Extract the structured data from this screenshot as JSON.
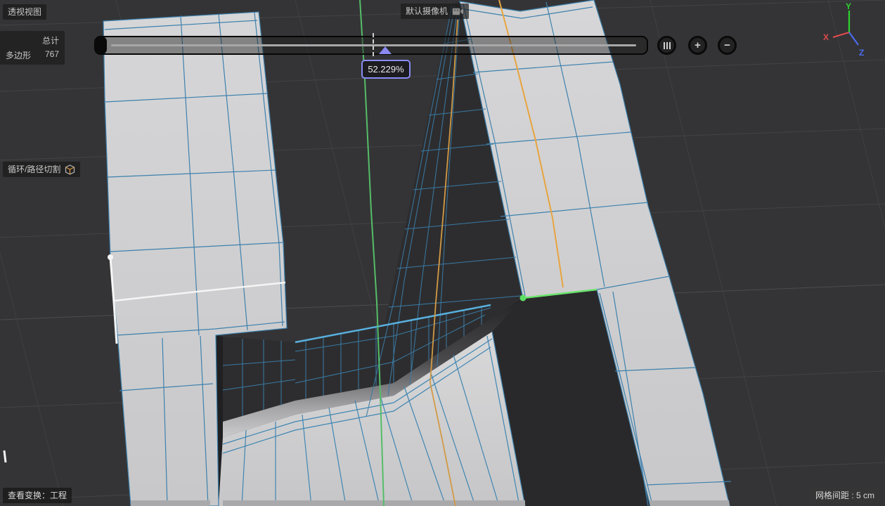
{
  "viewport": {
    "view_label": "透视视图",
    "camera_label": "默认摄像机",
    "stats": {
      "total_label": "总计",
      "polygons_label": "多边形",
      "polygons_value": "767"
    },
    "tool_hint": {
      "label": "循环/路径切割"
    },
    "status_bar": {
      "view_transform": "查看变换：工程",
      "grid_spacing": "网格间距 : 5 cm"
    }
  },
  "timeline": {
    "value_tooltip": "52.229%"
  },
  "controls": {
    "bars_icon": "triple-bars",
    "plus_label": "+",
    "minus_label": "−"
  },
  "axis_gizmo": {
    "x_label": "X",
    "y_label": "Y",
    "z_label": "Z",
    "x_color": "#e04b4b",
    "y_color": "#2ed32e",
    "z_color": "#4a6cf0"
  },
  "scene_colors": {
    "wireframe_blue": "#3e81ad",
    "selected_edge_blue": "#58b0de",
    "cut_preview_orange": "#e8a43f",
    "world_axis_green": "#55bd68",
    "selected_edge_green": "#6be36e",
    "selected_edge_white": "#f5f5f5",
    "mesh_gray": "#cfcfd1",
    "background": "#343436"
  }
}
